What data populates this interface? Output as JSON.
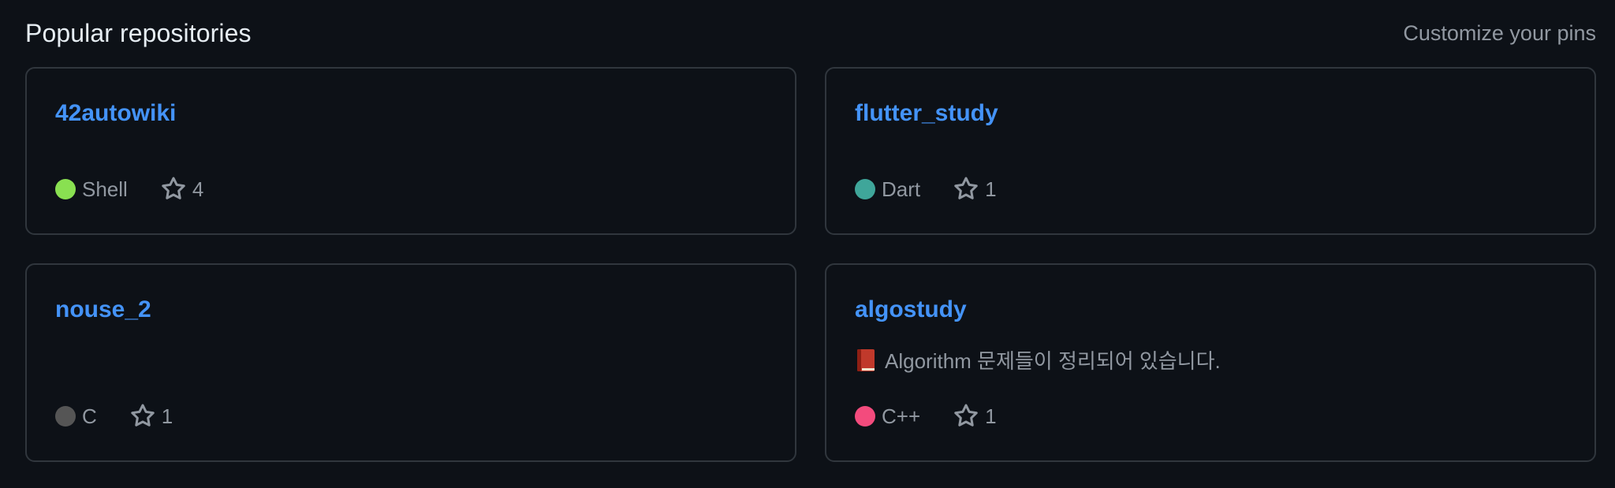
{
  "header": {
    "title": "Popular repositories",
    "customize_label": "Customize your pins"
  },
  "repos": [
    {
      "name": "42autowiki",
      "description": "",
      "language": "Shell",
      "language_color": "#89e051",
      "stars": "4"
    },
    {
      "name": "flutter_study",
      "description": "",
      "language": "Dart",
      "language_color": "#3fa69a",
      "stars": "1"
    },
    {
      "name": "nouse_2",
      "description": "",
      "language": "C",
      "language_color": "#555555",
      "stars": "1"
    },
    {
      "name": "algostudy",
      "description": "Algorithm 문제들이 정리되어 있습니다.",
      "description_icon": "red-book-icon",
      "language": "C++",
      "language_color": "#f34b7d",
      "stars": "1"
    }
  ],
  "colors": {
    "background": "#0d1117",
    "border": "#30363d",
    "link": "#4493f8",
    "muted": "#9198a1"
  }
}
